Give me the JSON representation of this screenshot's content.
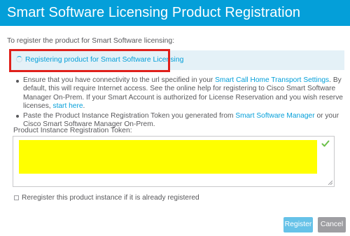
{
  "dialog": {
    "title": "Smart Software Licensing Product Registration",
    "intro": "To register the product for Smart Software licensing:"
  },
  "status": {
    "text": "Registering product for Smart Software Licensing",
    "icon": "spinner-icon"
  },
  "instructions": [
    {
      "before": "Ensure that you have connectivity to the url specified in your ",
      "link": "Smart Call Home Transport Settings",
      "mid": ". By default, this will require Internet access. See the online help for registering to Cisco Smart Software Manager On-Prem. If your Smart Account is authorized for License Reservation and you wish reserve licenses, ",
      "link2": "start here",
      "after": "."
    },
    {
      "before": "Paste the Product Instance Registration Token you generated from ",
      "link": "Smart Software Manager",
      "after": " or your Cisco Smart Software Manager On-Prem."
    }
  ],
  "token": {
    "label": "Product Instance Registration Token:",
    "value": "",
    "valid_icon": "check-icon",
    "redaction_color": "#ffff00"
  },
  "reregister": {
    "label": "Reregister this product instance if it is already registered",
    "checked": false
  },
  "buttons": {
    "register": "Register",
    "cancel": "Cancel"
  },
  "colors": {
    "header": "#049fd9",
    "link": "#049fd9",
    "status_bg": "#e4f1f7",
    "highlight_border": "#e0201b",
    "register_button": "#66c2e8",
    "cancel_button": "#9e9ea2"
  }
}
